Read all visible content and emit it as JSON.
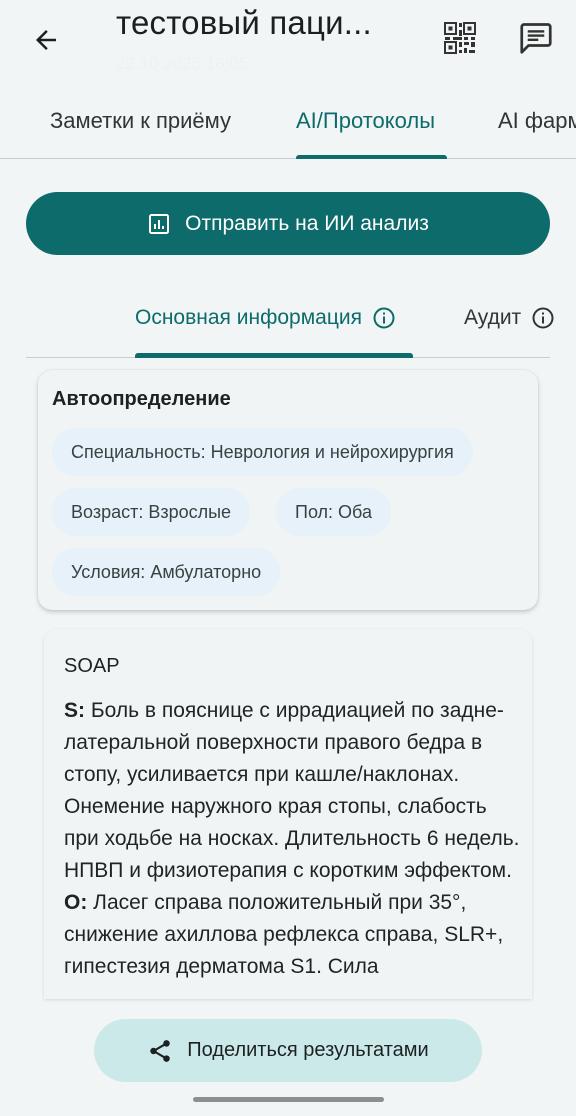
{
  "appbar": {
    "title": "тестовый паци...",
    "subtitle": "22.10.2025 16:05",
    "icons": {
      "back": "arrow-left-icon",
      "qr": "qr-code-icon",
      "chat": "chat-icon"
    }
  },
  "tabs": [
    {
      "label": "Заметки к приёму",
      "active": false
    },
    {
      "label": "AI/Протоколы",
      "active": true
    },
    {
      "label": "AI фарм",
      "active": false
    }
  ],
  "primary_button": {
    "label": "Отправить на ИИ анализ",
    "icon": "analytics-icon"
  },
  "subtabs": [
    {
      "label": "Основная информация",
      "icon": "info-icon",
      "active": true
    },
    {
      "label": "Аудит",
      "icon": "info-icon",
      "active": false
    }
  ],
  "auto_card": {
    "title": "Автоопределение",
    "chips": [
      "Специальность: Неврология и нейрохирургия",
      "Возраст: Взрослые",
      "Пол: Оба",
      "Условия: Амбулаторно"
    ]
  },
  "soap_card": {
    "title": "SOAP",
    "s_label": "S:",
    "s_text": " Боль в пояснице с иррадиацией по задне-латеральной поверхности правого бедра в стопу, усиливается при кашле/наклонах. Онемение наружного края стопы, слабость при ходьбе на носках. Длительность 6 недель. НПВП и физиотерапия с коротким эффектом.",
    "o_label": "O:",
    "o_text": " Ласег справа положительный при 35°, снижение ахиллова рефлекса справа, SLR+, гипестезия дерматома S1. Сила"
  },
  "share_button": {
    "label": "Поделиться результатами",
    "icon": "share-icon"
  },
  "colors": {
    "accent": "#0d6b6b",
    "chip": "#e6f1fa",
    "share_bg": "#cce9e9",
    "background": "#f2f5f5"
  }
}
